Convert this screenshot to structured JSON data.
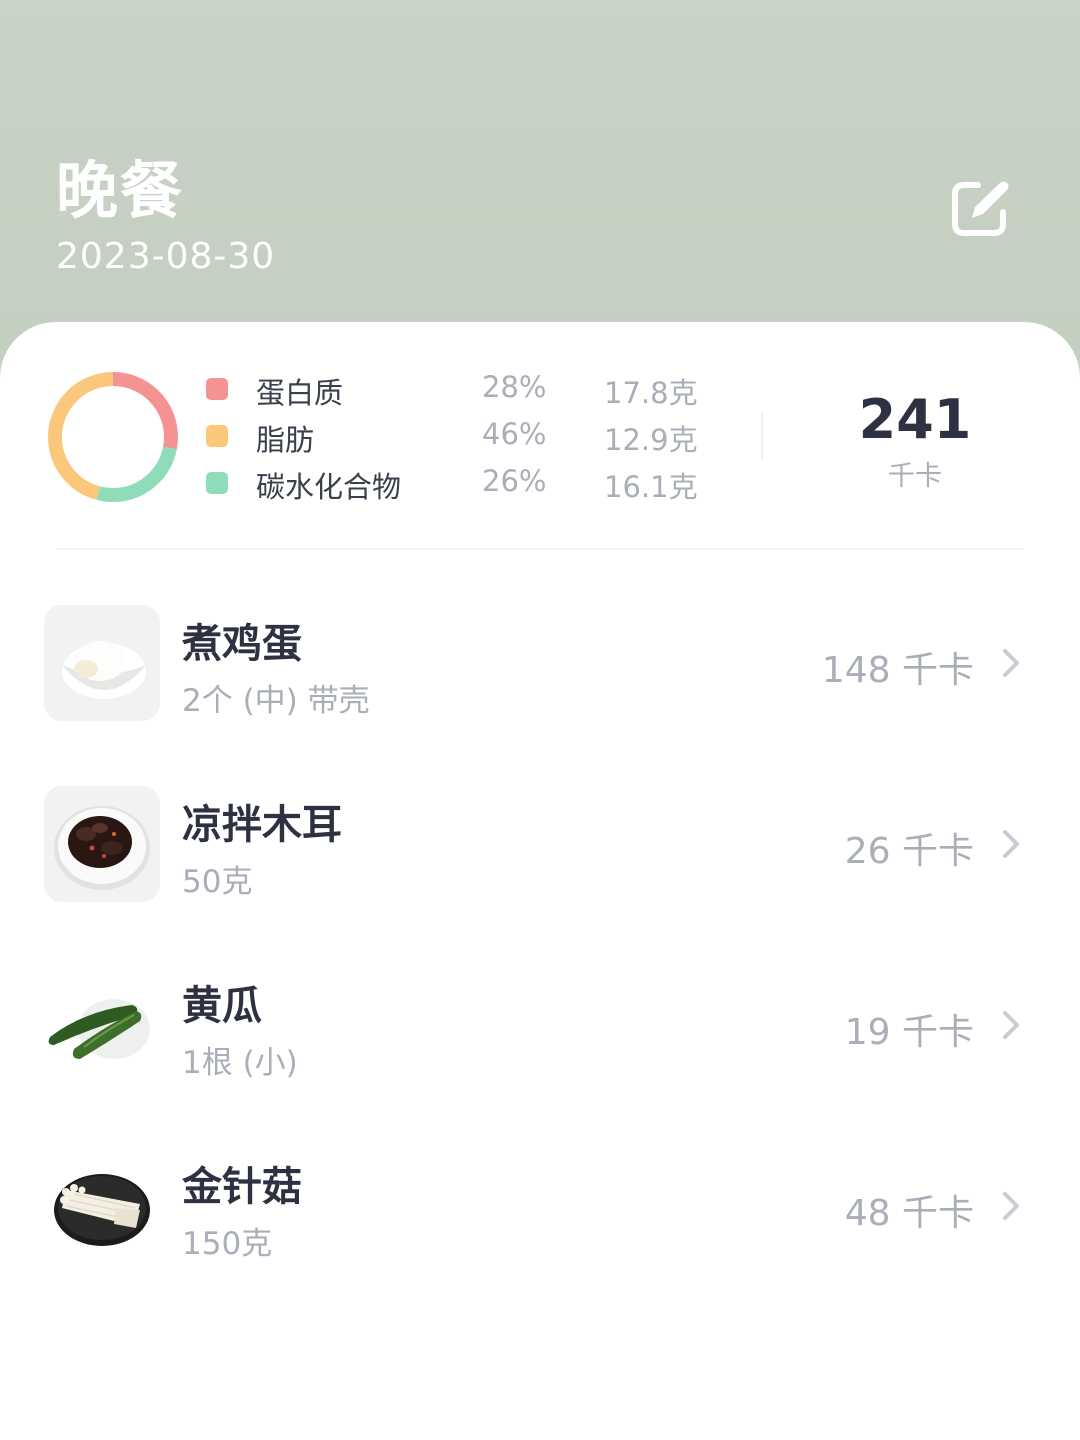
{
  "header": {
    "title": "晚餐",
    "date": "2023-08-30"
  },
  "nutrition": {
    "macros": [
      {
        "name": "蛋白质",
        "percent": "28%",
        "grams": "17.8克",
        "share": 0.28,
        "color": "#f59292"
      },
      {
        "name": "脂肪",
        "percent": "46%",
        "grams": "12.9克",
        "share": 0.46,
        "color": "#fbc87b"
      },
      {
        "name": "碳水化合物",
        "percent": "26%",
        "grams": "16.1克",
        "share": 0.26,
        "color": "#8fdcb9"
      }
    ],
    "total_kcal": "241",
    "total_unit": "千卡"
  },
  "foods": [
    {
      "name": "煮鸡蛋",
      "portion": "2个 (中) 带壳",
      "kcal": "148 千卡",
      "icon": "boiled-egg-image"
    },
    {
      "name": "凉拌木耳",
      "portion": "50克",
      "kcal": "26 千卡",
      "icon": "wood-ear-salad-image"
    },
    {
      "name": "黄瓜",
      "portion": "1根 (小)",
      "kcal": "19 千卡",
      "icon": "cucumber-image"
    },
    {
      "name": "金针菇",
      "portion": "150克",
      "kcal": "48 千卡",
      "icon": "enoki-mushroom-image"
    }
  ],
  "colors": {
    "header_bg": "#c6d2c3",
    "text_primary": "#2d3142",
    "text_secondary": "#a9aeb8"
  }
}
